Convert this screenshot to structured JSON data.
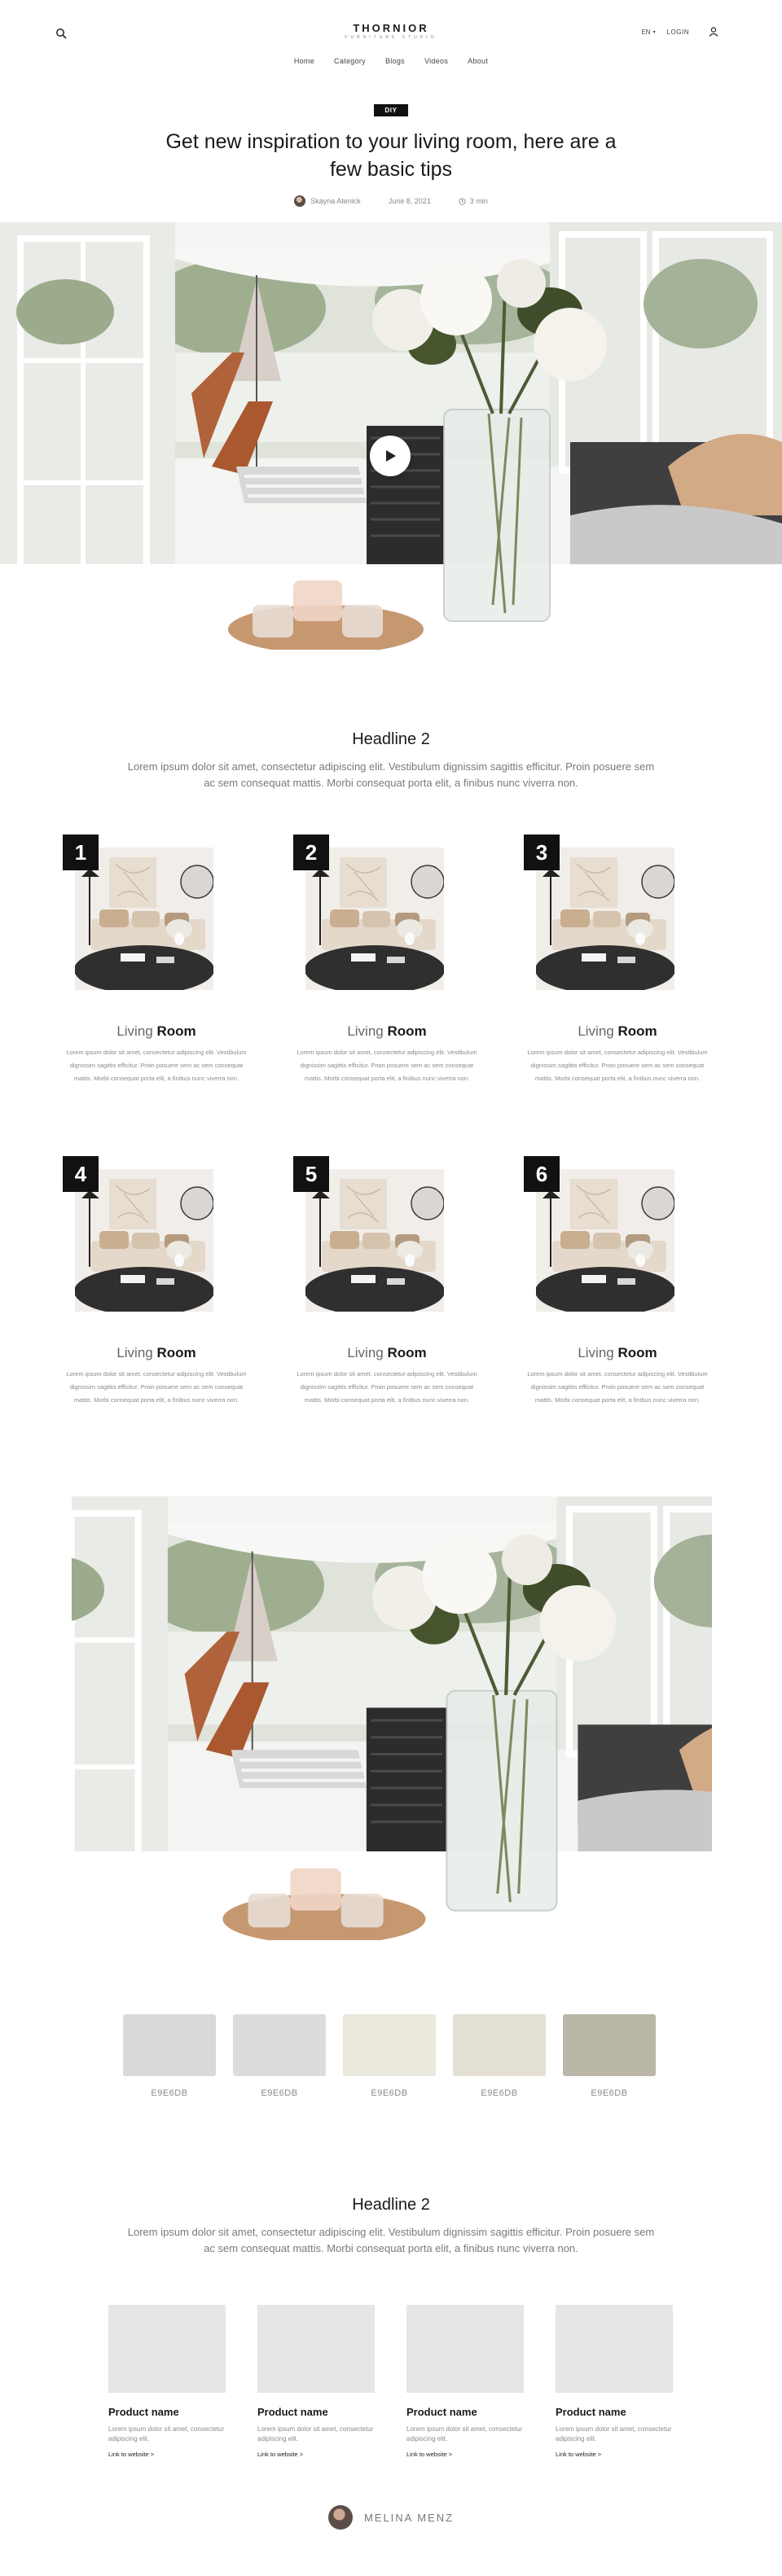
{
  "header": {
    "logo_title": "THORNIOR",
    "logo_subtitle": "FURNITURE STUDIO",
    "language": "EN",
    "login_label": "LOGIN",
    "nav": [
      {
        "label": "Home"
      },
      {
        "label": "Category"
      },
      {
        "label": "Blogs"
      },
      {
        "label": "Videos"
      },
      {
        "label": "About"
      }
    ]
  },
  "article": {
    "tag": "DIY",
    "title": "Get new inspiration to your living room, here are a few basic tips",
    "author": "Skayna Atenick",
    "date": "June 8, 2021",
    "read_time": "3 min"
  },
  "section1": {
    "headline": "Headline 2",
    "lead": "Lorem ipsum dolor sit amet, consectetur adipiscing elit. Vestibulum dignissim sagittis efficitur. Proin posuere sem ac sem consequat mattis. Morbi consequat porta elit, a finibus nunc viverra non."
  },
  "cards": [
    {
      "number": "1",
      "title_light": "Living",
      "title_bold": "Room",
      "body": "Lorem ipsum dolor sit amet, consectetur adipiscing elit. Vestibulum dignissim sagittis efficitur. Proin posuere sem ac sem consequat mattis. Morbi consequat porta elit, a finibus nunc viverra non."
    },
    {
      "number": "2",
      "title_light": "Living",
      "title_bold": "Room",
      "body": "Lorem ipsum dolor sit amet, consectetur adipiscing elit. Vestibulum dignissim sagittis efficitur. Proin posuere sem ac sem consequat mattis. Morbi consequat porta elit, a finibus nunc viverra non."
    },
    {
      "number": "3",
      "title_light": "Living",
      "title_bold": "Room",
      "body": "Lorem ipsum dolor sit amet, consectetur adipiscing elit. Vestibulum dignissim sagittis efficitur. Proin posuere sem ac sem consequat mattis. Morbi consequat porta elit, a finibus nunc viverra non."
    },
    {
      "number": "4",
      "title_light": "Living",
      "title_bold": "Room",
      "body": "Lorem ipsum dolor sit amet, consectetur adipiscing elit. Vestibulum dignissim sagittis efficitur. Proin posuere sem ac sem consequat mattis. Morbi consequat porta elit, a finibus nunc viverra non."
    },
    {
      "number": "5",
      "title_light": "Living",
      "title_bold": "Room",
      "body": "Lorem ipsum dolor sit amet, consectetur adipiscing elit. Vestibulum dignissim sagittis efficitur. Proin posuere sem ac sem consequat mattis. Morbi consequat porta elit, a finibus nunc viverra non."
    },
    {
      "number": "6",
      "title_light": "Living",
      "title_bold": "Room",
      "body": "Lorem ipsum dolor sit amet, consectetur adipiscing elit. Vestibulum dignissim sagittis efficitur. Proin posuere sem ac sem consequat mattis. Morbi consequat porta elit, a finibus nunc viverra non."
    }
  ],
  "swatches": [
    {
      "label": "E9E6DB",
      "color": "#d9d9d9"
    },
    {
      "label": "E9E6DB",
      "color": "#dcdcdc"
    },
    {
      "label": "E9E6DB",
      "color": "#ebe8dd"
    },
    {
      "label": "E9E6DB",
      "color": "#e4e0d3"
    },
    {
      "label": "E9E6DB",
      "color": "#bbb7a8"
    }
  ],
  "section2": {
    "headline": "Headline 2",
    "lead": "Lorem ipsum dolor sit amet, consectetur adipiscing elit. Vestibulum dignissim sagittis efficitur. Proin posuere sem ac sem consequat mattis. Morbi consequat porta elit, a finibus nunc viverra non."
  },
  "products": [
    {
      "name": "Product name",
      "description": "Lorem ipsum dolor sit amet, consectetur adipiscing elit.",
      "link": "Link to website >"
    },
    {
      "name": "Product name",
      "description": "Lorem ipsum dolor sit amet, consectetur adipiscing elit.",
      "link": "Link to website >"
    },
    {
      "name": "Product name",
      "description": "Lorem ipsum dolor sit amet, consectetur adipiscing elit.",
      "link": "Link to website >"
    },
    {
      "name": "Product name",
      "description": "Lorem ipsum dolor sit amet, consectetur adipiscing elit.",
      "link": "Link to website >"
    }
  ],
  "footer": {
    "author_name": "MELINA MENZ"
  }
}
